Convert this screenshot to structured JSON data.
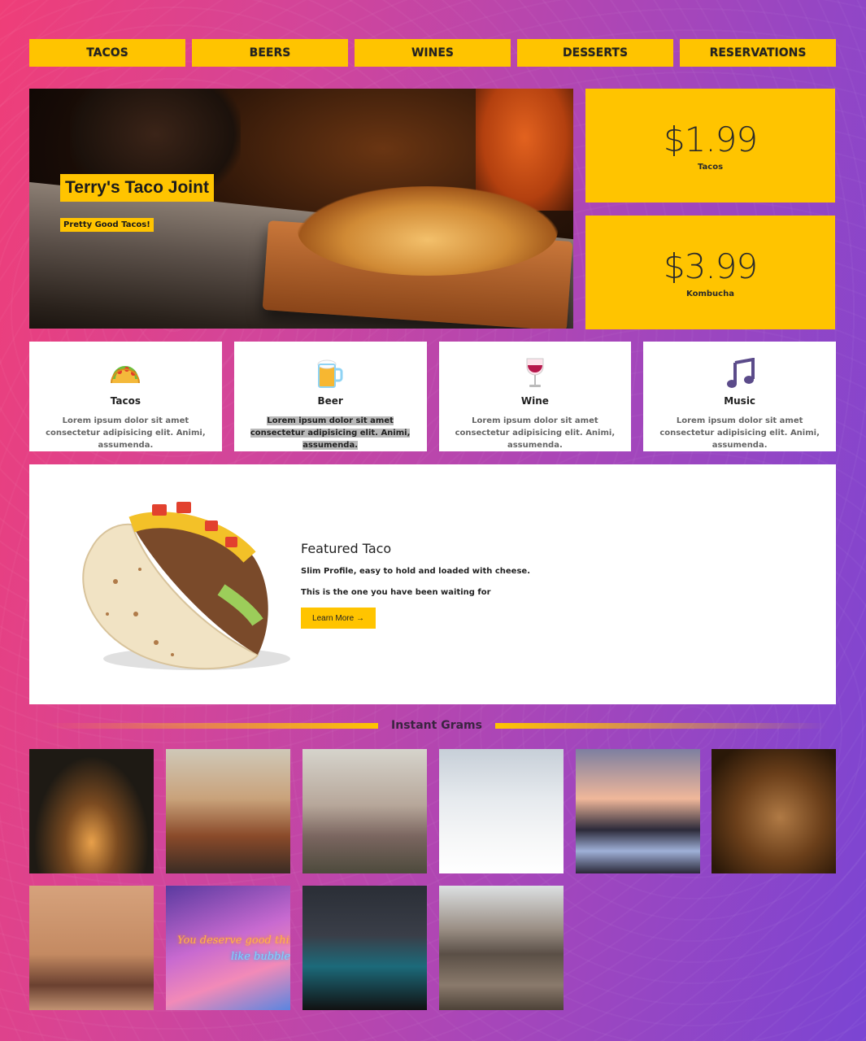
{
  "nav": {
    "items": [
      "TACOS",
      "BEERS",
      "WINES",
      "DESSERTS",
      "RESERVATIONS"
    ]
  },
  "hero": {
    "title": "Terry's Taco Joint",
    "subtitle": "Pretty Good Tacos!"
  },
  "prices": [
    {
      "amount": "$1.99",
      "label": "Tacos"
    },
    {
      "amount": "$3.99",
      "label": "Kombucha"
    }
  ],
  "features": [
    {
      "icon": "taco-icon",
      "title": "Tacos",
      "text": "Lorem ipsum dolor sit amet consectetur adipisicing elit. Animi, assumenda."
    },
    {
      "icon": "beer-icon",
      "title": "Beer",
      "text": "Lorem ipsum dolor sit amet consectetur adipisicing elit. Animi, assumenda."
    },
    {
      "icon": "wine-icon",
      "title": "Wine",
      "text": "Lorem ipsum dolor sit amet consectetur adipisicing elit. Animi, assumenda."
    },
    {
      "icon": "music-icon",
      "title": "Music",
      "text": "Lorem ipsum dolor sit amet consectetur adipisicing elit. Animi, assumenda."
    }
  ],
  "featured": {
    "title": "Featured Taco",
    "line1": "Slim Profile, easy to hold and loaded with cheese.",
    "line2": "This is the one you have been waiting for",
    "button": "Learn More →"
  },
  "grams": {
    "title": "Instant Grams",
    "photos": [
      "nativity-scene-photo",
      "wedding-couple-photo",
      "bride-bouquet-photo",
      "snowy-street-photo",
      "sea-stacks-sunset-photo",
      "woman-blanket-photo",
      "three-women-photo",
      "neon-sign-photo",
      "blue-car-photo",
      "campfire-photo"
    ],
    "neon_text": "You deserve good things",
    "neon_text2": "like bubble t"
  },
  "colors": {
    "accent": "#ffc400",
    "bg_start": "#ef3e78",
    "bg_end": "#7b45d3"
  }
}
